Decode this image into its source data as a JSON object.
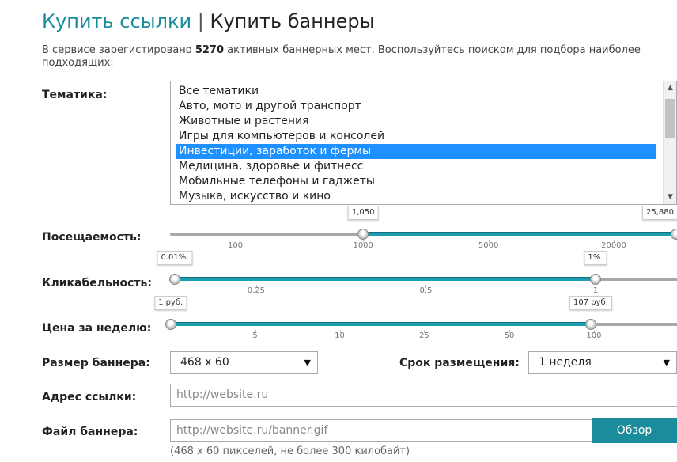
{
  "header": {
    "link_text": "Купить ссылки",
    "separator": "|",
    "current": "Купить баннеры"
  },
  "description": {
    "pre": "В сервисе зарегистировано",
    "count": "5270",
    "post": "активных баннерных мест. Воспользуйтесь поиском для подбора наиболее подходящих:"
  },
  "topic": {
    "label": "Тематика:",
    "options": [
      "Все тематики",
      "Авто, мото и другой транспорт",
      "Животные и растения",
      "Игры для компьютеров и консолей",
      "Инвестиции, заработок и фермы",
      "Медицина, здоровье и фитнесс",
      "Мобильные телефоны и гаджеты",
      "Музыка, искусство и кино"
    ],
    "selected_index": 4,
    "scroll_up_glyph": "▲",
    "scroll_down_glyph": "▼"
  },
  "sliders": [
    {
      "key": "traffic",
      "label": "Посещаемость:",
      "min_label": "1,050",
      "max_label": "25,880",
      "min_pos": 0.37,
      "max_pos": 0.97,
      "ticks": [
        "100",
        "1000",
        "5000",
        "20000"
      ],
      "tick_pos": [
        0.125,
        0.37,
        0.61,
        0.85
      ]
    },
    {
      "key": "ctr",
      "label": "Кликабельность:",
      "min_label": "0.01%.",
      "max_label": "1%.",
      "min_pos": 0.009,
      "max_pos": 0.815,
      "ticks": [
        "0.25",
        "0.5",
        "1"
      ],
      "tick_pos": [
        0.165,
        0.49,
        0.815
      ]
    },
    {
      "key": "price",
      "label": "Цена за неделю:",
      "min_label": "1 руб.",
      "max_label": "107 руб.",
      "min_pos": 0.001,
      "max_pos": 0.806,
      "ticks": [
        "5",
        "10",
        "25",
        "50",
        "100"
      ],
      "tick_pos": [
        0.163,
        0.325,
        0.487,
        0.65,
        0.812
      ]
    }
  ],
  "banner_size": {
    "label": "Размер баннера:",
    "value": "468 x 60",
    "arrow": "▼"
  },
  "duration": {
    "label": "Срок размещения:",
    "value": "1 неделя",
    "arrow": "▼"
  },
  "link_address": {
    "label": "Адрес ссылки:",
    "placeholder": "http://website.ru"
  },
  "banner_file": {
    "label": "Файл баннера:",
    "placeholder": "http://website.ru/banner.gif",
    "browse_label": "Обзор",
    "hint": "(468 x 60 пикселей, не более 300 килобайт)"
  }
}
